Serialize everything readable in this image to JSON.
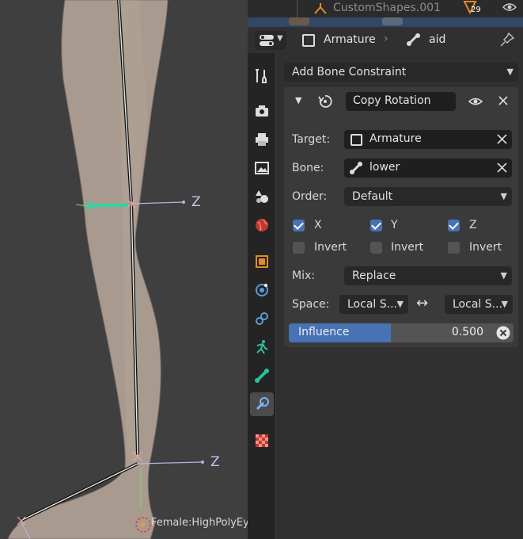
{
  "viewport": {
    "axis_labels": [
      "Z",
      "Z"
    ],
    "object_label": "Female:HighPolyEy"
  },
  "outliner": {
    "item_name": "CustomShapes.001",
    "item_count": "29"
  },
  "header": {
    "object_name": "Armature",
    "bone_name": "aid"
  },
  "tabs": [
    {
      "name": "tool-tab",
      "icon": "wrench-screwdriver-icon"
    },
    {
      "name": "render-tab",
      "icon": "camera-back-icon"
    },
    {
      "name": "output-tab",
      "icon": "printer-icon"
    },
    {
      "name": "view-layer-tab",
      "icon": "image-icon"
    },
    {
      "name": "scene-tab",
      "icon": "scene-icon"
    },
    {
      "name": "world-tab",
      "icon": "globe-icon"
    },
    {
      "name": "object-tab",
      "icon": "orange-square-icon"
    },
    {
      "name": "modifiers-tab",
      "icon": "physics-icon"
    },
    {
      "name": "particles-tab",
      "icon": "constraint-ring-icon"
    },
    {
      "name": "object-data-tab",
      "icon": "running-figure-icon"
    },
    {
      "name": "bone-tab",
      "icon": "bone-icon"
    },
    {
      "name": "bone-constraints-tab",
      "icon": "bone-constraint-icon"
    },
    {
      "name": "texture-tab",
      "icon": "checker-icon"
    }
  ],
  "add_constraint_label": "Add Bone Constraint",
  "constraint": {
    "name": "Copy Rotation",
    "target_label": "Target:",
    "target_value": "Armature",
    "bone_label": "Bone:",
    "bone_value": "lower",
    "order_label": "Order:",
    "order_value": "Default",
    "axes": [
      {
        "label": "X",
        "checked": true
      },
      {
        "label": "Y",
        "checked": true
      },
      {
        "label": "Z",
        "checked": true
      }
    ],
    "invert_label": "Invert",
    "mix_label": "Mix:",
    "mix_value": "Replace",
    "space_label": "Space:",
    "owner_space": "Local S...",
    "target_space": "Local S...",
    "swap_symbol": "↔",
    "influence_label": "Influence",
    "influence_value": "0.500",
    "influence_fraction": 0.5
  },
  "colors": {
    "accent": "#4772b3",
    "panel_bg": "#303030",
    "field_bg": "#1f1f1f",
    "bone_green": "#2fbf9a",
    "object_orange": "#e08a2c"
  }
}
